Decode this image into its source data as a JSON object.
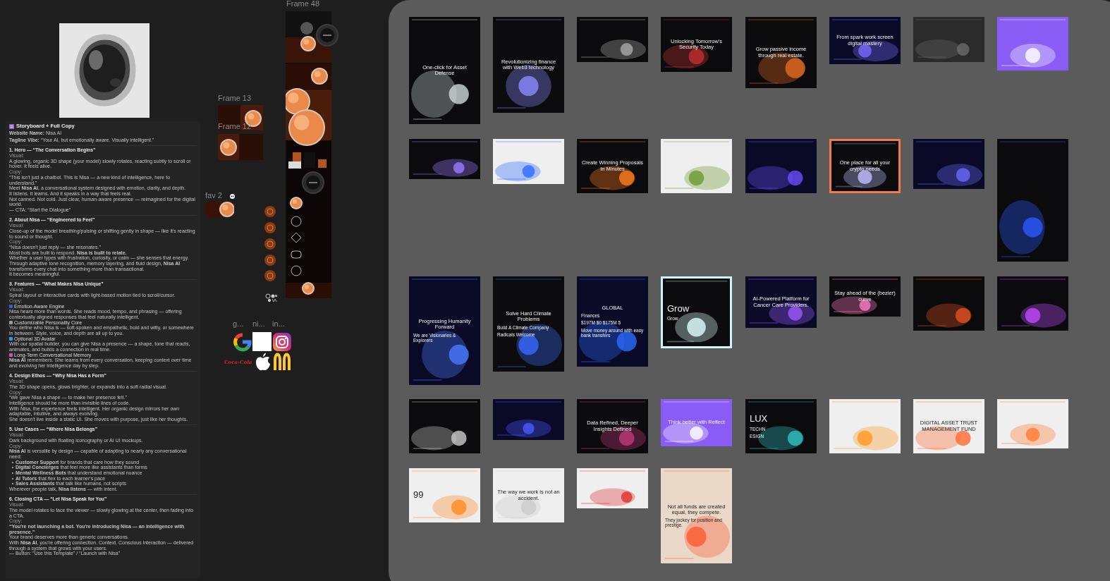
{
  "storyboard_image": {
    "kind": "picture"
  },
  "storyboard": {
    "title": "Storyboard + Full Copy",
    "meta": [
      "**Website Name:** Nisa AI",
      "**Tagline Vibe:** “Your AI, but emotionally aware. Visually intelligent.”"
    ],
    "sections": [
      {
        "heading": "1. Hero — “The Conversation Begins”",
        "blocks": [
          {
            "kind": "label",
            "text": "Visual:"
          },
          {
            "kind": "para",
            "text": "A glowing, organic 3D shape (your model) slowly rotates, reacting subtly to scroll or hover. It feels alive."
          },
          {
            "kind": "label",
            "text": "Copy:"
          },
          {
            "kind": "para",
            "text": "“This isn't just a chatbot. This is Nisa — a new kind of intelligence, here to understand.”"
          },
          {
            "kind": "para",
            "text": "Meet **Nisa AI**, a conversational system designed with emotion, clarity, and depth."
          },
          {
            "kind": "para",
            "text": "It listens. It learns. And it speaks in a way that feels real."
          },
          {
            "kind": "para",
            "text": "Not canned. Not cold. Just clear, human-aware presence — reimagined for the digital world."
          },
          {
            "kind": "para",
            "text": "— CTA: “Start the Dialogue”"
          }
        ]
      },
      {
        "heading": "2. About Nisa — “Engineered to Feel”",
        "blocks": [
          {
            "kind": "label",
            "text": "Visual:"
          },
          {
            "kind": "para",
            "text": "Close-up of the model breathing/pulsing or shifting gently in shape — like it's reacting to sound or thought."
          },
          {
            "kind": "label",
            "text": "Copy:"
          },
          {
            "kind": "para",
            "text": "“Nisa doesn't just reply — she resonates.”"
          },
          {
            "kind": "para",
            "text": "Most bots are built to respond. **Nisa is built to relate.**"
          },
          {
            "kind": "para",
            "text": "Whether a user types with frustration, curiosity, or calm — she senses that energy. Through adaptive tone recognition, memory layering, and fluid design, **Nisa AI** transforms every chat into something more than transactional."
          },
          {
            "kind": "para",
            "text": "It becomes meaningful."
          }
        ]
      },
      {
        "heading": "3. Features — “What Makes Nisa Unique”",
        "blocks": [
          {
            "kind": "label",
            "text": "Visual:"
          },
          {
            "kind": "para",
            "text": "Spiral layout or interactive cards with light-based motion tied to scroll/cursor."
          },
          {
            "kind": "label",
            "text": "Copy:"
          },
          {
            "kind": "feature",
            "text": "Emotion-Aware Engine",
            "color": "#3b5bdb"
          },
          {
            "kind": "para",
            "text": "Nisa hears more than words. She reads mood, tempo, and phrasing — offering contextually aligned responses that feel naturally intelligent."
          },
          {
            "kind": "feature",
            "text": "Customizable Personality Core",
            "color": "#9a9a9a"
          },
          {
            "kind": "para",
            "text": "You define who Nisa is — soft-spoken and empathetic, bold and witty, or somewhere in between. Style, voice, and depth are all up to you."
          },
          {
            "kind": "feature",
            "text": "Optional 3D Avatar",
            "color": "#4d8fd6"
          },
          {
            "kind": "para",
            "text": "With our spatial builder, you can give Nisa a presence — a shape, tone that reacts, animates, and builds a connection in real time."
          },
          {
            "kind": "feature",
            "text": "Long-Term Conversational Memory",
            "color": "#d94fb0"
          },
          {
            "kind": "para",
            "text": "**Nisa AI** remembers. She learns from every conversation, keeping context over time and evolving her intelligence day by step."
          }
        ]
      },
      {
        "heading": "4. Design Ethos — “Why Nisa Has a Form”",
        "blocks": [
          {
            "kind": "label",
            "text": "Visual:"
          },
          {
            "kind": "para",
            "text": "The 3D shape opens, glows brighter, or expands into a soft radial visual."
          },
          {
            "kind": "label",
            "text": "Copy:"
          },
          {
            "kind": "para",
            "text": "“We gave Nisa a shape — to make her presence felt.”"
          },
          {
            "kind": "para",
            "text": "Intelligence should be more than invisible lines of code."
          },
          {
            "kind": "para",
            "text": "With Nisa, the experience feels intelligent. Her organic design mirrors her own adaptable, intuitive, and always evolving."
          },
          {
            "kind": "para",
            "text": "She doesn't live inside a static UI. She moves with purpose, just like her thoughts."
          }
        ]
      },
      {
        "heading": "5. Use Cases — “Where Nisa Belongs”",
        "blocks": [
          {
            "kind": "label",
            "text": "Visual:"
          },
          {
            "kind": "para",
            "text": "Dark background with floating iconography or AI UI mockups."
          },
          {
            "kind": "label",
            "text": "Copy:"
          },
          {
            "kind": "para",
            "text": "**Nisa AI** is versatile by design — capable of adapting to nearly any conversational need:"
          },
          {
            "kind": "bullet",
            "text": "**Customer Support** for brands that care how they sound"
          },
          {
            "kind": "bullet",
            "text": "**Digital Concierges** that feel more like assistants than forms"
          },
          {
            "kind": "bullet",
            "text": "**Mental Wellness Bots** that understand emotional nuance"
          },
          {
            "kind": "bullet",
            "text": "**AI Tutors** that flex to each learner's pace"
          },
          {
            "kind": "bullet",
            "text": "**Sales Assistants** that talk like humans, not scripts"
          },
          {
            "kind": "para",
            "text": "Wherever people talk, **Nisa listens** — with intent."
          }
        ]
      },
      {
        "heading": "6. Closing CTA — “Let Nisa Speak for You”",
        "blocks": [
          {
            "kind": "label",
            "text": "Visual:"
          },
          {
            "kind": "para",
            "text": "The model rotates to face the viewer — slowly glowing at the center, then fading into a CTA."
          },
          {
            "kind": "label",
            "text": "Copy:"
          },
          {
            "kind": "para",
            "text": "**“You're not launching a bot. You're introducing Nisa — an intelligence with presence.”**"
          },
          {
            "kind": "para",
            "text": "Your brand deserves more than generic conversations."
          },
          {
            "kind": "para",
            "text": "With **Nisa AI**, you're offering connection. Context. Conscious interaction — delivered through a system that grows with your users."
          },
          {
            "kind": "para",
            "text": "— Button: “Use this Template” / “Launch with Nisa”"
          }
        ]
      }
    ]
  },
  "frames": [
    {
      "label": "Frame 48"
    },
    {
      "label": "Frame 13"
    },
    {
      "label": "Frame 12"
    },
    {
      "label": "fav 2"
    }
  ],
  "logo_labels": [
    "g...",
    "ni...",
    "in..."
  ],
  "wordmark": "Coca-Cola",
  "design_thumbnails": [
    {
      "kind": "page",
      "texts": [
        "One-click for Asset Defense"
      ]
    },
    {
      "kind": "page",
      "texts": [
        "Revolutionizing finance with Web3 technology"
      ]
    },
    {
      "kind": "picture"
    },
    {
      "kind": "page",
      "texts": [
        "Unlocking Tomorrow's Security Today"
      ]
    },
    {
      "kind": "page",
      "texts": [
        "Grow passive income through real estate."
      ]
    },
    {
      "kind": "page",
      "texts": [
        "From spark work screen digital mastery"
      ]
    },
    {
      "kind": "picture"
    },
    {
      "kind": "picture"
    },
    {
      "kind": "picture"
    },
    {
      "kind": "picture"
    },
    {
      "kind": "page",
      "texts": [
        "Create Winning Proposals In Minutes"
      ]
    },
    {
      "kind": "picture"
    },
    {
      "kind": "picture"
    },
    {
      "kind": "page",
      "texts": [
        "One place for all your crypto needs"
      ]
    },
    {
      "kind": "picture"
    },
    {
      "kind": "picture"
    },
    {
      "kind": "page",
      "texts": [
        "Progressing Humanity Forward",
        "We are Visionaries & Explorers"
      ]
    },
    {
      "kind": "page",
      "texts": [
        "Solve Hard Climate Problems",
        "Build A Climate Company",
        "Radicals Welcome"
      ]
    },
    {
      "kind": "page",
      "texts": [
        "GLOBAL",
        "Finances",
        "$197M  $0  $175M  5",
        "Move money around with easy bank transfers"
      ]
    },
    {
      "kind": "page",
      "texts": [
        "Grow",
        "Grow"
      ]
    },
    {
      "kind": "page",
      "texts": [
        "AI-Powered Platform for Cancer Care Providers."
      ]
    },
    {
      "kind": "page",
      "texts": [
        "Stay ahead of the (bezier) curve"
      ]
    },
    {
      "kind": "picture"
    },
    {
      "kind": "picture"
    },
    {
      "kind": "picture"
    },
    {
      "kind": "picture"
    },
    {
      "kind": "page",
      "texts": [
        "Data Refined, Deeper Insights Defined"
      ]
    },
    {
      "kind": "page",
      "texts": [
        "Think better with Reflect"
      ]
    },
    {
      "kind": "page",
      "texts": [
        "LUX",
        "TECHN",
        "ESIGN"
      ]
    },
    {
      "kind": "picture"
    },
    {
      "kind": "page",
      "texts": [
        "DIGITAL ASSET TRUST MANAGEMENT FUND"
      ]
    },
    {
      "kind": "picture"
    },
    {
      "kind": "page",
      "texts": [
        "99"
      ]
    },
    {
      "kind": "page",
      "texts": [
        "The way we work is not an accident."
      ]
    },
    {
      "kind": "picture"
    },
    {
      "kind": "page",
      "texts": [
        "Not all funds are created equal, they compete.",
        "They jockey for position and prestige."
      ]
    }
  ]
}
